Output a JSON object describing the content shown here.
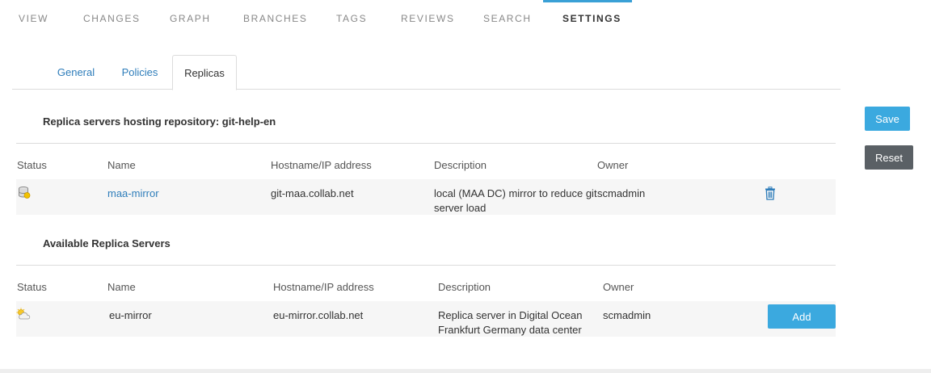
{
  "nav": {
    "tabs": [
      "VIEW",
      "CHANGES",
      "GRAPH",
      "BRANCHES",
      "TAGS",
      "REVIEWS",
      "SEARCH",
      "SETTINGS"
    ],
    "active": "SETTINGS"
  },
  "subtabs": [
    "General",
    "Policies",
    "Replicas"
  ],
  "hosting": {
    "title": "Replica servers hosting repository: git-help-en",
    "headers": [
      "Status",
      "Name",
      "Hostname/IP address",
      "Description",
      "Owner"
    ],
    "rows": [
      {
        "status_icon": "database-icon",
        "name": "maa-mirror",
        "hostname": "git-maa.collab.net",
        "description_line1": "local (MAA DC) mirror to reduce git",
        "description_line2": "server load",
        "owner": "scmadmin",
        "action_icon": "trash-icon"
      }
    ]
  },
  "available": {
    "title": "Available Replica Servers",
    "headers": [
      "Status",
      "Name",
      "Hostname/IP address",
      "Description",
      "Owner"
    ],
    "rows": [
      {
        "status_icon": "partly-cloudy-icon",
        "name": "eu-mirror",
        "hostname": "eu-mirror.collab.net",
        "description_line1": "Replica server in Digital Ocean",
        "description_line2": "Frankfurt Germany data center",
        "owner": "scmadmin",
        "action_label": "Add"
      }
    ]
  },
  "buttons": {
    "save": "Save",
    "reset": "Reset"
  },
  "colors": {
    "accent": "#3ba9df",
    "link": "#2e7dba",
    "reset": "#5a6065"
  }
}
